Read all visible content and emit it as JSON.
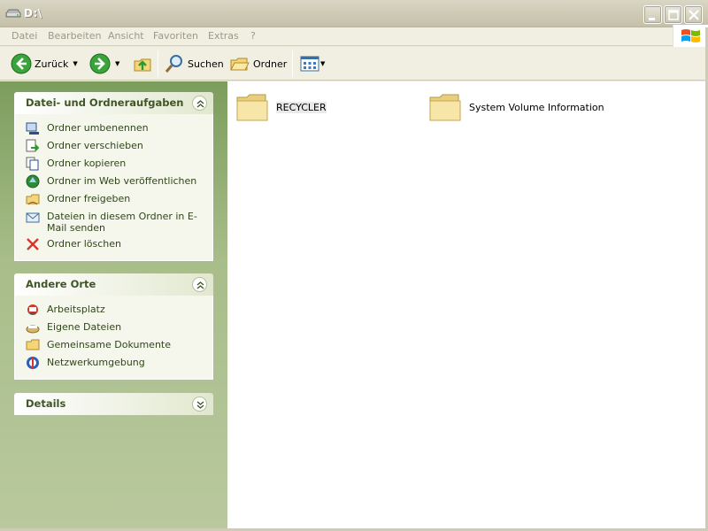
{
  "window": {
    "title": "D:\\"
  },
  "menu": {
    "items": [
      "Datei",
      "Bearbeiten",
      "Ansicht",
      "Favoriten",
      "Extras",
      "?"
    ]
  },
  "toolbar": {
    "back_label": "Zurück",
    "search_label": "Suchen",
    "folders_label": "Ordner"
  },
  "sidebar": {
    "tasks": {
      "title": "Datei- und Ordneraufgaben",
      "items": [
        {
          "label": "Ordner umbenennen",
          "icon": "rename-icon"
        },
        {
          "label": "Ordner verschieben",
          "icon": "move-icon"
        },
        {
          "label": "Ordner kopieren",
          "icon": "copy-icon"
        },
        {
          "label": "Ordner im Web veröffentlichen",
          "icon": "publish-web-icon"
        },
        {
          "label": "Ordner freigeben",
          "icon": "share-icon"
        },
        {
          "label": "Dateien in diesem Ordner in E-Mail senden",
          "icon": "email-icon"
        },
        {
          "label": "Ordner löschen",
          "icon": "delete-icon"
        }
      ]
    },
    "places": {
      "title": "Andere Orte",
      "items": [
        {
          "label": "Arbeitsplatz",
          "icon": "my-computer-icon"
        },
        {
          "label": "Eigene Dateien",
          "icon": "my-documents-icon"
        },
        {
          "label": "Gemeinsame Dokumente",
          "icon": "shared-documents-icon"
        },
        {
          "label": "Netzwerkumgebung",
          "icon": "network-icon"
        }
      ]
    },
    "details": {
      "title": "Details"
    }
  },
  "files": [
    {
      "name": "RECYCLER",
      "icon": "folder-icon"
    },
    {
      "name": "System Volume Information",
      "icon": "folder-icon"
    }
  ],
  "colors": {
    "sidebar_gradient_top": "#7b9d5c",
    "sidebar_header_text": "#3f5528",
    "task_text": "#2e4619",
    "titlebar": "#cfcbb6"
  }
}
